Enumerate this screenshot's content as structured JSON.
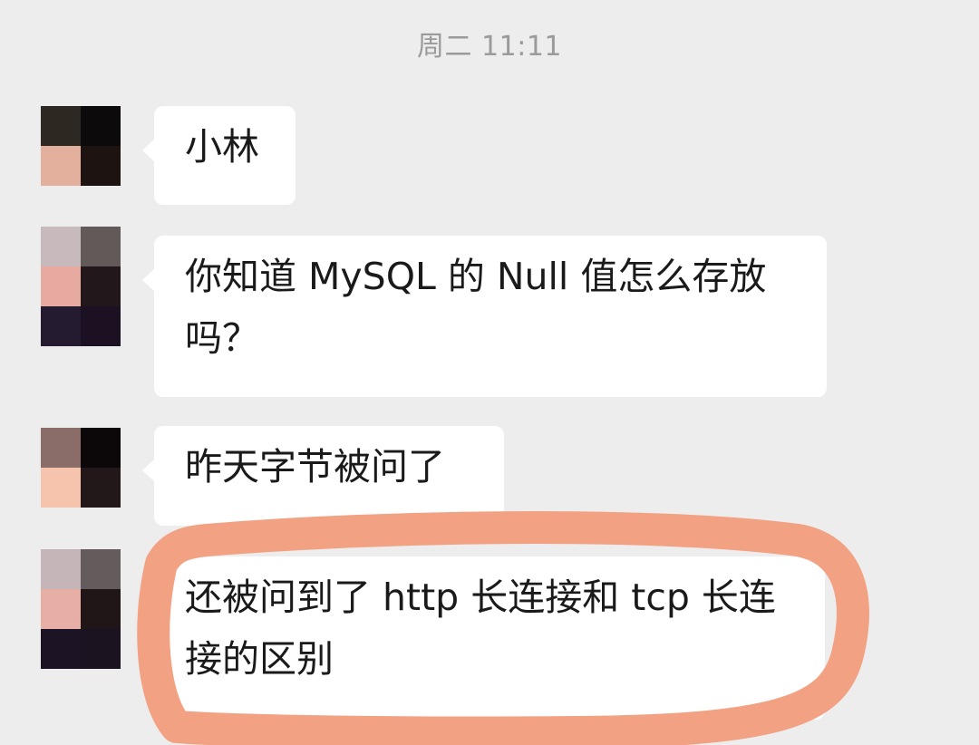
{
  "chat": {
    "timestamp": "周二 11:11",
    "messages": [
      {
        "text": "小林",
        "avatar_cells": [
          "#2d2822",
          "#0d0a0b",
          "#e3b09e",
          "#1d1412"
        ]
      },
      {
        "text": "你知道 MySQL 的 Null 值怎么存放吗？",
        "avatar_cells": [
          "#c8b9bc",
          "#625a58",
          "#e6aaa0",
          "#22171a",
          "#241b31",
          "#1b1122"
        ]
      },
      {
        "text": "昨天字节被问了",
        "avatar_cells": [
          "#8a6c68",
          "#0c080a",
          "#f6c3ac",
          "#221819"
        ]
      },
      {
        "text": "还被问到了 http 长连接和 tcp 长连接的区别",
        "avatar_cells": [
          "#c5b5b8",
          "#645b5d",
          "#e7aea5",
          "#201617",
          "#1c1325",
          "#1b1420"
        ]
      }
    ]
  },
  "annotation": {
    "color": "#f2a183",
    "target": "last-message"
  }
}
